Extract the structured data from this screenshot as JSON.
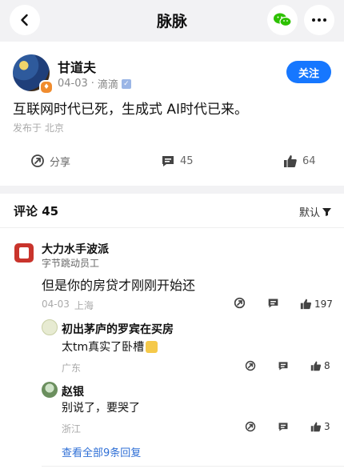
{
  "header": {
    "title": "脉脉"
  },
  "post": {
    "author": "甘道夫",
    "date": "04-03",
    "company": "滴滴",
    "follow_label": "关注",
    "content": "互联网时代已死，生成式 AI时代已来。",
    "location": "发布于 北京",
    "share_label": "分享",
    "comment_count": "45",
    "like_count": "64"
  },
  "comments_section": {
    "title": "评论 45",
    "sort_label": "默认"
  },
  "comments": [
    {
      "author": "大力水手波派",
      "subtitle": "字节跳动员工",
      "text": "但是你的房贷才刚刚开始还",
      "meta_date": "04-03",
      "meta_loc": "上海",
      "likes": "197"
    }
  ],
  "replies": [
    {
      "author": "初出茅庐的罗宾在买房",
      "text": "太tm真实了卧槽",
      "meta": "广东",
      "likes": "8"
    },
    {
      "author": "赵银",
      "text": "别说了，要哭了",
      "meta": "浙江",
      "likes": "3"
    }
  ],
  "more_replies_label": "查看全部9条回复",
  "colors": {
    "accent": "#1677ff",
    "wechat": "#2dc100"
  }
}
